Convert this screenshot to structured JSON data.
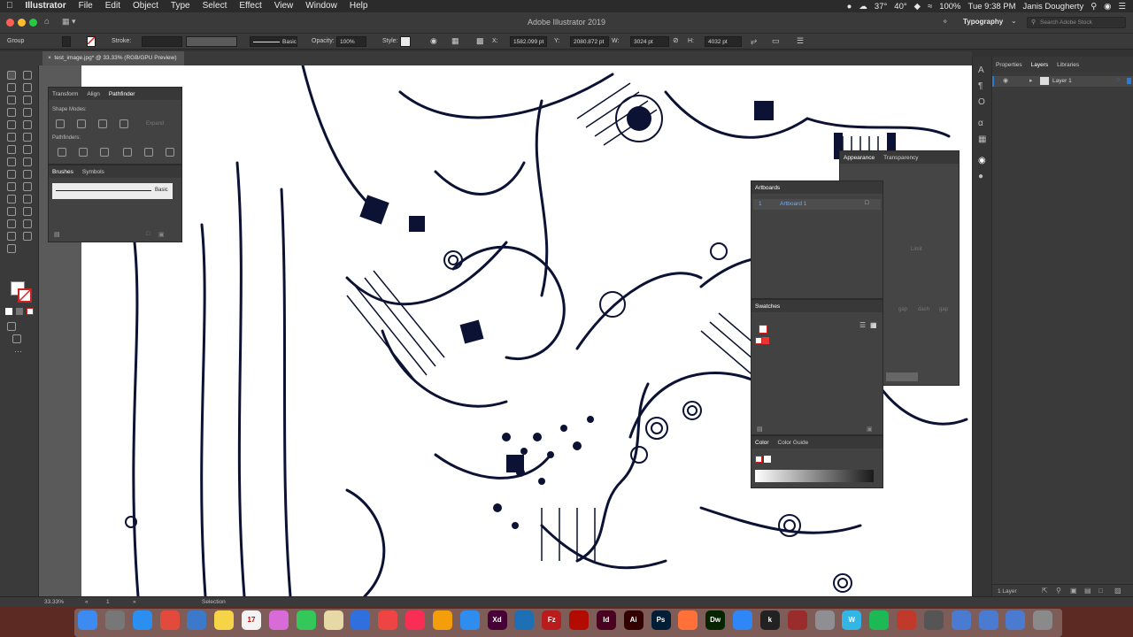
{
  "menubar": {
    "apple_icon": "apple-icon",
    "app_name": "Illustrator",
    "items": [
      "File",
      "Edit",
      "Object",
      "Type",
      "Select",
      "Effect",
      "View",
      "Window",
      "Help"
    ],
    "status": {
      "temp1": "37°",
      "temp2": "40°",
      "battery": "100%",
      "clock": "Tue 9:38 PM",
      "user": "Janis Dougherty"
    }
  },
  "titlebar": {
    "title": "Adobe Illustrator 2019",
    "workspace": "Typography",
    "search_placeholder": "Search Adobe Stock"
  },
  "controlbar": {
    "selection_label": "Group",
    "stroke_label": "Stroke:",
    "brush_label": "Basic",
    "opacity_label": "Opacity:",
    "opacity_value": "100%",
    "style_label": "Style:",
    "x_label": "X:",
    "x_value": "1582.099 pt",
    "y_label": "Y:",
    "y_value": "2080.872 pt",
    "w_label": "W:",
    "w_value": "3024 pt",
    "h_label": "H:",
    "h_value": "4032 pt"
  },
  "document": {
    "tab_label": "test_image.jpg* @ 33.33% (RGB/GPU Preview)",
    "close_icon": "close-icon"
  },
  "pathfinder_panel": {
    "tabs": [
      "Transform",
      "Align",
      "Pathfinder"
    ],
    "shape_modes_label": "Shape Modes:",
    "expand_label": "Expand",
    "pathfinders_label": "Pathfinders:"
  },
  "brushes_panel": {
    "tabs": [
      "Brushes",
      "Symbols"
    ],
    "brush_name": "Basic"
  },
  "appearance_panel": {
    "tabs": [
      "Appearance",
      "Transparency"
    ],
    "limit_label": "Limit",
    "gap_labels": [
      "gap",
      "dash",
      "gap"
    ]
  },
  "artboards_panel": {
    "title": "Artboards",
    "row_number": "1",
    "row_name": "Artboard 1"
  },
  "swatches_panel": {
    "title": "Swatches"
  },
  "color_panel": {
    "tabs": [
      "Color",
      "Color Guide"
    ]
  },
  "right_dock": {
    "tabs": [
      "Properties",
      "Layers",
      "Libraries"
    ],
    "layer_name": "Layer 1",
    "footer": "1 Layer"
  },
  "statusbar": {
    "zoom": "33.33%",
    "artboard_num": "1",
    "tool": "Selection"
  },
  "dock": {
    "apps": [
      "Finder",
      "Launchpad",
      "Safari",
      "Chrome",
      "Preview",
      "Notes",
      "Calendar",
      "Photos",
      "Messages",
      "TextEdit",
      "Keynote",
      "News",
      "Music",
      "Books",
      "App Store",
      "Xd",
      "Compass",
      "FileZilla",
      "Acrobat",
      "Id",
      "Ai",
      "Ps",
      "Firefox",
      "Dw",
      "Mail",
      "kindle",
      "Dictionary",
      "Settings",
      "W",
      "Spotify",
      "Photo Booth",
      "Screen",
      "Folder",
      "Folder",
      "Downloads",
      "Trash"
    ],
    "calendar_day": "17"
  },
  "colors": {
    "accent": "#2e7bd3",
    "menubar_bg": "#2b2b2b",
    "panel_bg": "#424242",
    "artboard_bg": "#ffffff",
    "ink": "#0c1233",
    "dock_bg": "#5c2a22"
  }
}
